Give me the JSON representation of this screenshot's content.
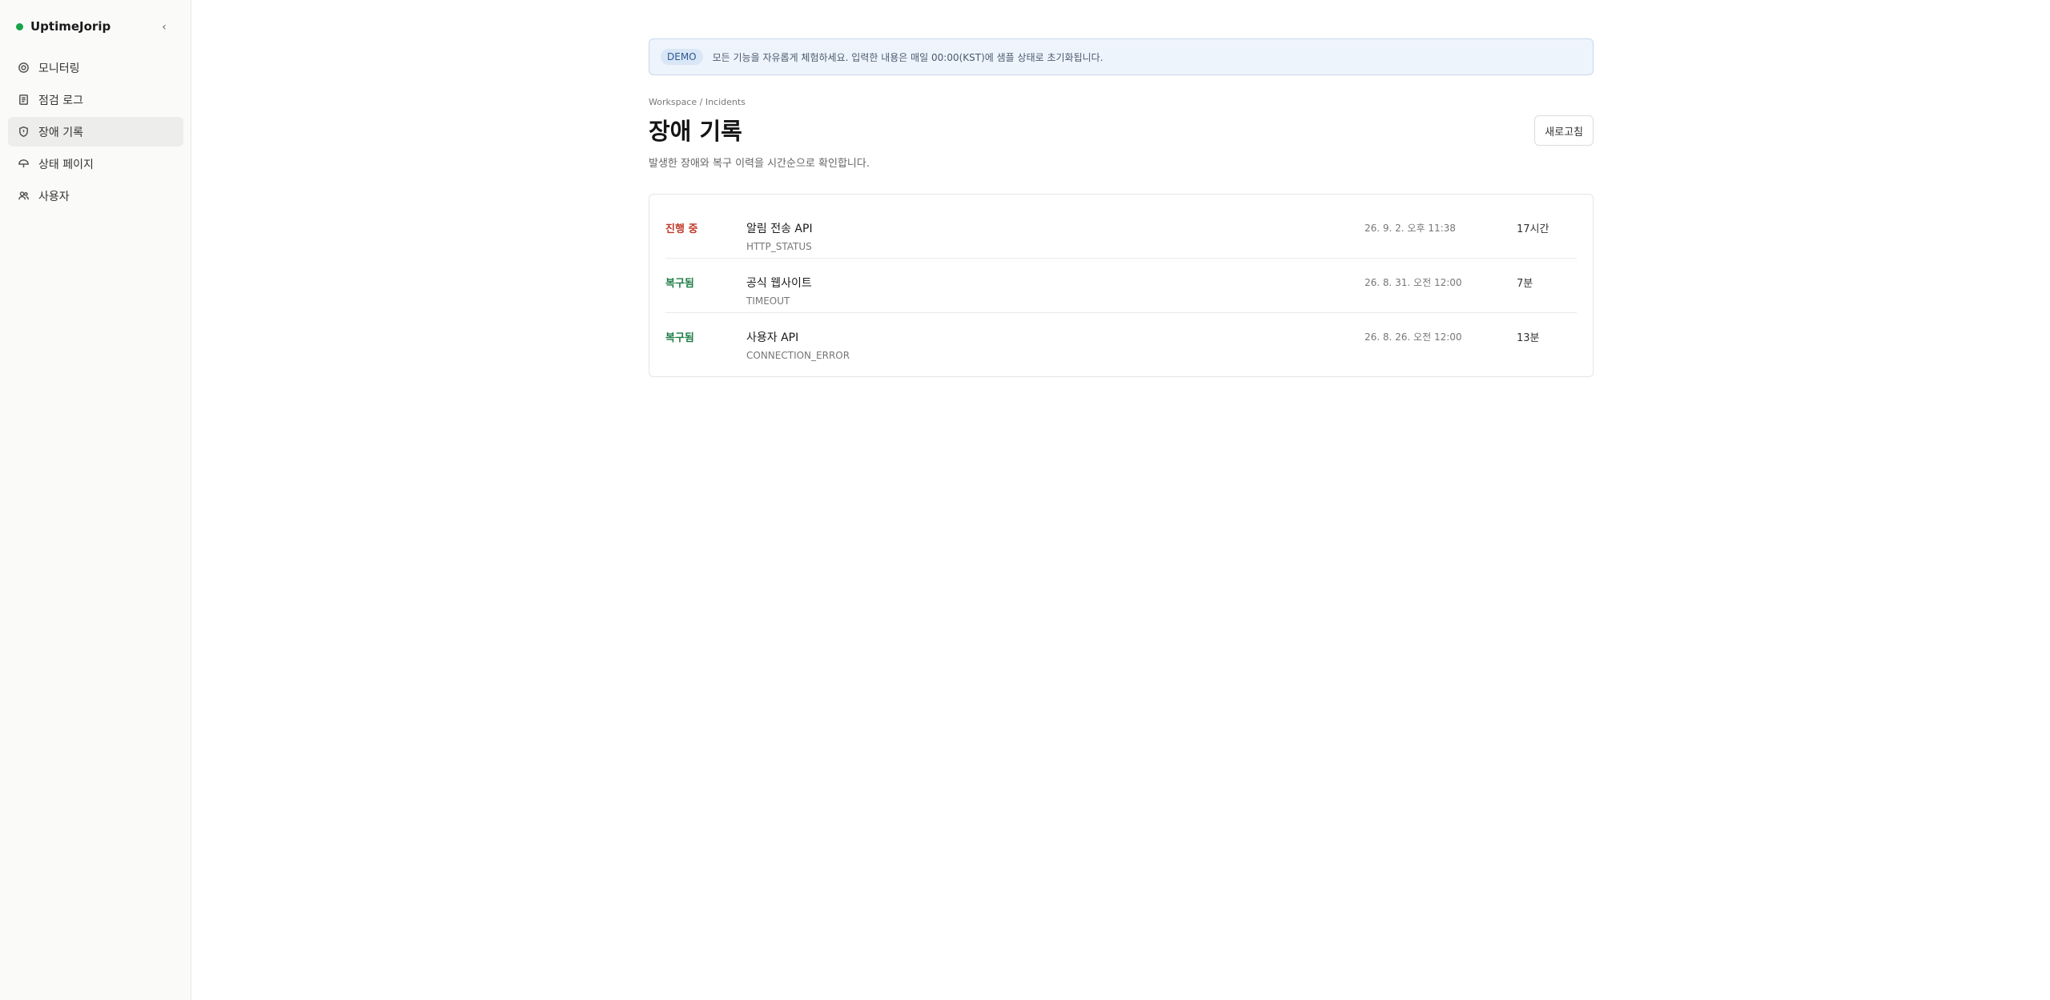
{
  "app": {
    "name": "UptimeJorip"
  },
  "sidebar": {
    "items": [
      {
        "label": "모니터링",
        "icon": "monitor-icon",
        "active": false
      },
      {
        "label": "점검 로그",
        "icon": "log-icon",
        "active": false
      },
      {
        "label": "장애 기록",
        "icon": "shield-icon",
        "active": true
      },
      {
        "label": "상태 페이지",
        "icon": "umbrella-icon",
        "active": false
      },
      {
        "label": "사용자",
        "icon": "users-icon",
        "active": false
      }
    ]
  },
  "banner": {
    "badge": "DEMO",
    "text": "모든 기능을 자유롭게 체험하세요. 입력한 내용은 매일 00:00(KST)에 샘플 상태로 초기화됩니다."
  },
  "page": {
    "breadcrumb": "Workspace / Incidents",
    "title": "장애 기록",
    "subtitle": "발생한 장애와 복구 이력을 시간순으로 확인합니다.",
    "refresh_label": "새로고침"
  },
  "incidents": [
    {
      "status": "진행 중",
      "status_type": "open",
      "name": "알림 전송 API",
      "code": "HTTP_STATUS",
      "date": "26. 9. 2. 오후 11:38",
      "duration": "17시간"
    },
    {
      "status": "복구됨",
      "status_type": "recovered",
      "name": "공식 웹사이트",
      "code": "TIMEOUT",
      "date": "26. 8. 31. 오전 12:00",
      "duration": "7분"
    },
    {
      "status": "복구됨",
      "status_type": "recovered",
      "name": "사용자 API",
      "code": "CONNECTION_ERROR",
      "date": "26. 8. 26. 오전 12:00",
      "duration": "13분"
    }
  ],
  "colors": {
    "open": "#c0392b",
    "recovered": "#1e7d45",
    "brand_dot": "#16a34a"
  }
}
